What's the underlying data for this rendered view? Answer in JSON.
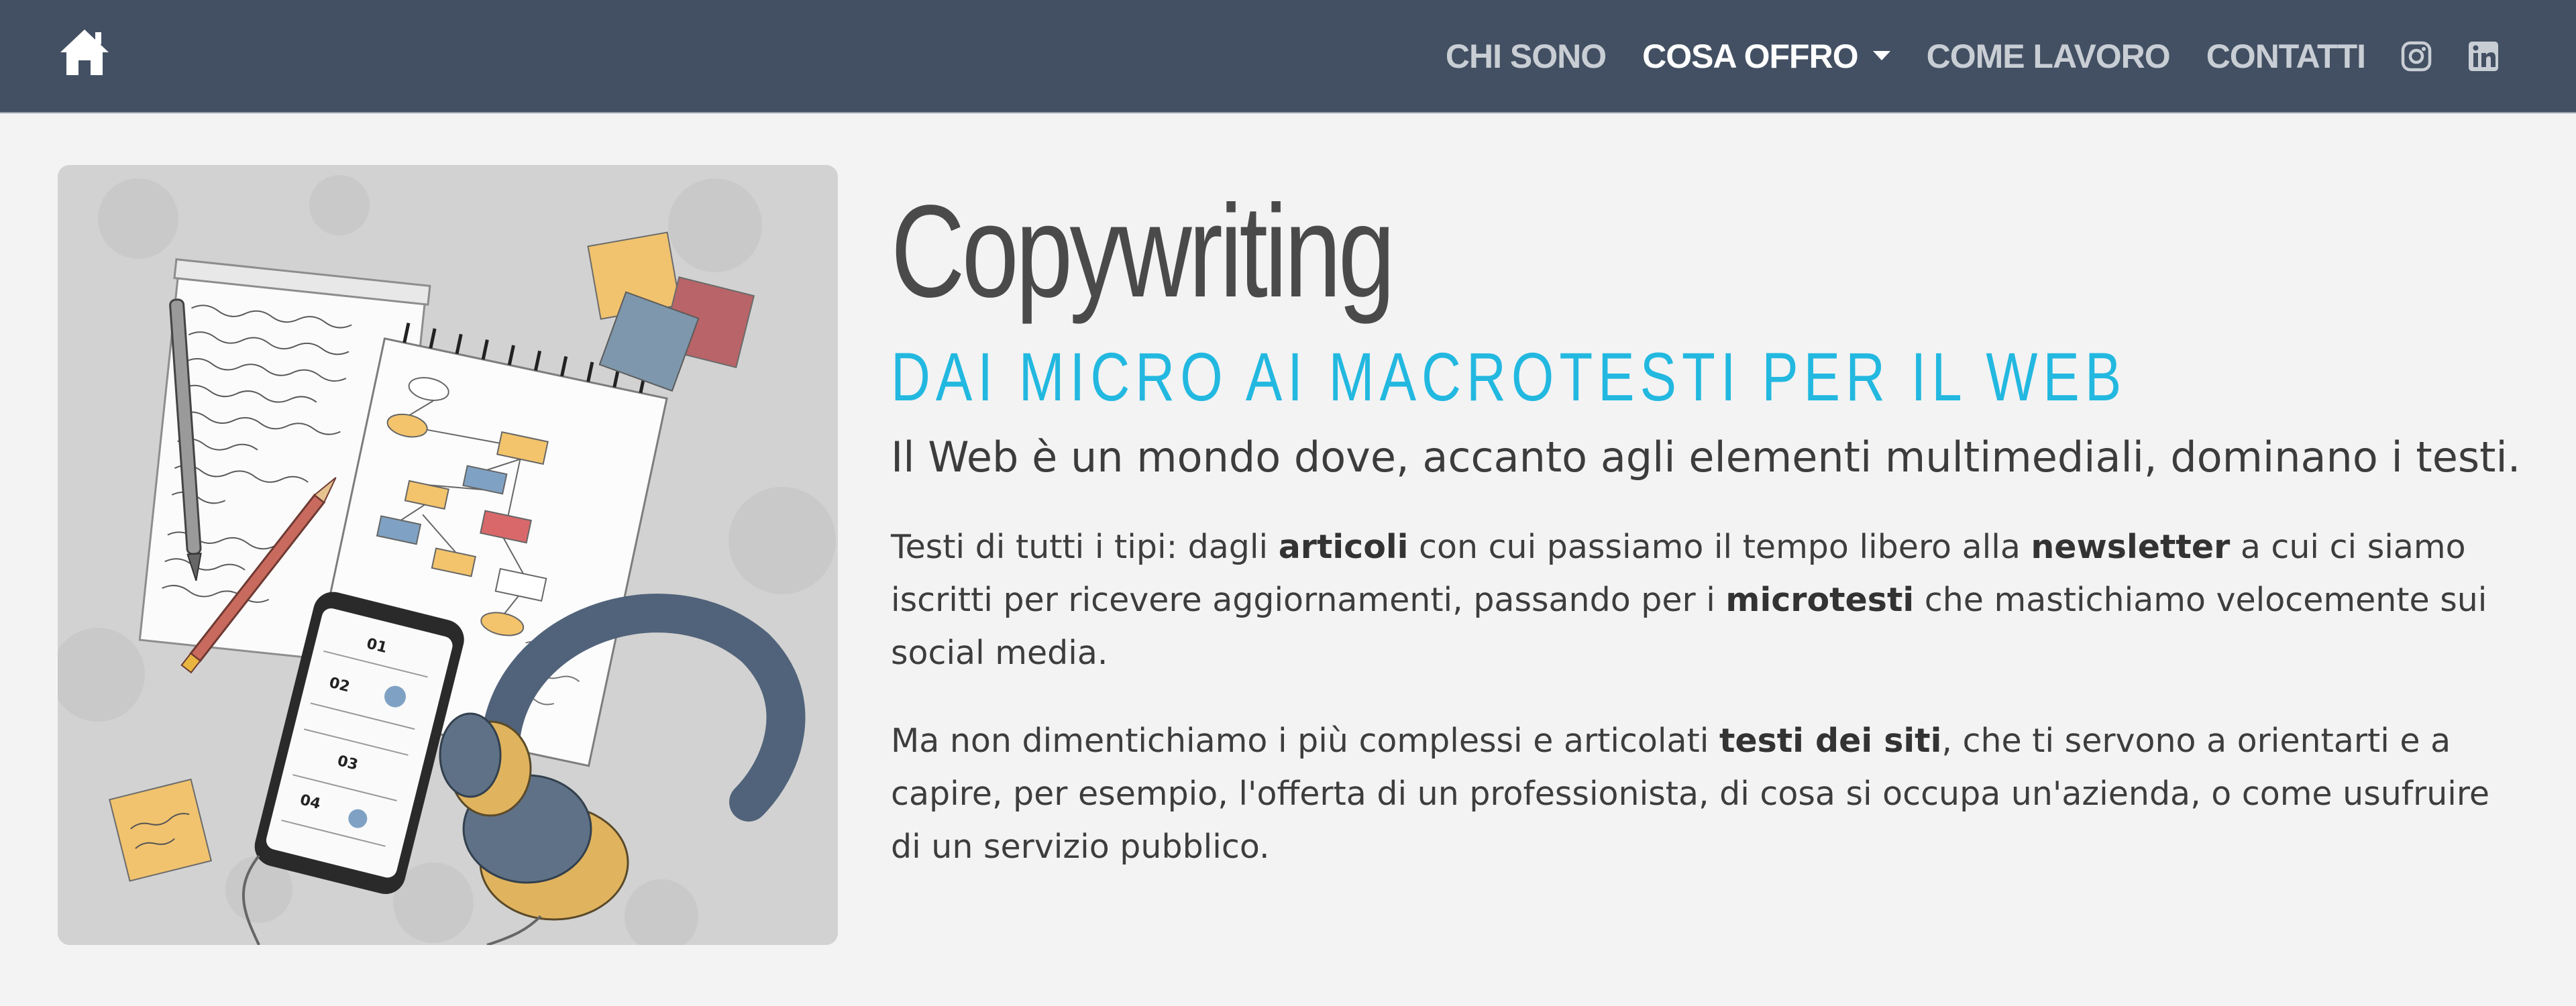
{
  "nav": {
    "home_icon": "home-icon",
    "items": [
      {
        "label": "CHI SONO",
        "active": false
      },
      {
        "label": "COSA OFFRO",
        "active": true,
        "dropdown": true
      },
      {
        "label": "COME LAVORO",
        "active": false
      },
      {
        "label": "CONTATTI",
        "active": false
      }
    ],
    "social_icons": [
      "instagram-icon",
      "linkedin-icon"
    ]
  },
  "hero": {
    "image_icon": "copywriting-illustration",
    "title": "Copywriting",
    "subtitle": "DAI MICRO AI MACROTESTI PER IL WEB",
    "lead": "Il Web è un mondo dove, accanto agli elementi multimediali, dominano i testi.",
    "paragraph1": {
      "t1": "Testi di tutti i tipi: dagli ",
      "b1": "articoli",
      "t2": " con cui passiamo il tempo libero alla ",
      "b2": "newsletter",
      "t3": " a cui ci siamo iscritti per ricevere aggiornamenti, passando per i ",
      "b3": "microtesti",
      "t4": " che mastichiamo velocemente sui social media."
    },
    "paragraph2": {
      "t1": "Ma non dimentichiamo i più complessi e articolati ",
      "b1": "testi dei siti",
      "t2": ", che ti servono a orientarti e a capire, per esempio, l'offerta di un professionista, di cosa si occupa un'azienda, o come usufruire di un servizio pubblico."
    }
  },
  "colors": {
    "navbar": "#435063",
    "accent": "#22b8e0",
    "background": "#f3f3f3"
  }
}
